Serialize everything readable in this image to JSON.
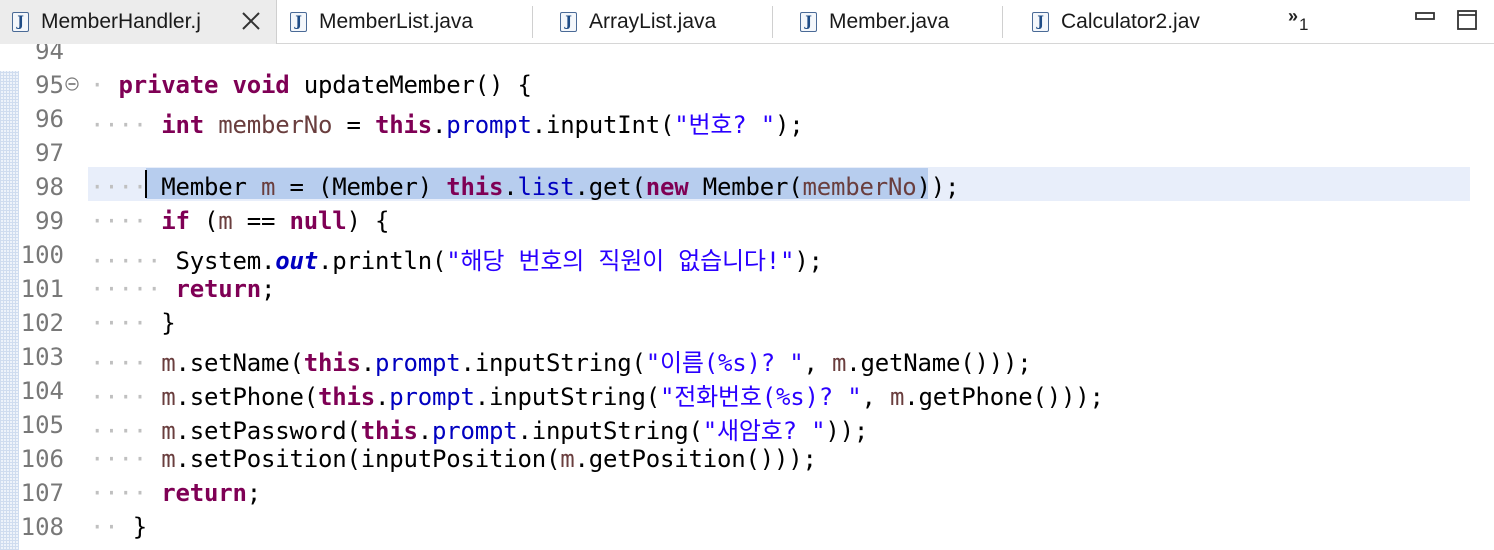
{
  "tabs": [
    {
      "label": "MemberHandler.j",
      "icon": "java-file-icon",
      "active": true
    },
    {
      "label": "MemberList.java",
      "icon": "java-file-icon"
    },
    {
      "label": "ArrayList.java",
      "icon": "java-file-icon"
    },
    {
      "label": "Member.java",
      "icon": "java-file-icon"
    },
    {
      "label": "Calculator2.jav",
      "icon": "java-file-icon"
    }
  ],
  "tab_overflow": {
    "label": "»",
    "count": "1"
  },
  "editor": {
    "lines": [
      {
        "num": "94",
        "code": ""
      },
      {
        "num": "95",
        "code": "private void updateMember() {"
      },
      {
        "num": "96",
        "code": "int memberNo = this.prompt.inputInt(\"번호? \");"
      },
      {
        "num": "97",
        "code": ""
      },
      {
        "num": "98",
        "code": "Member m = (Member) this.list.get(new Member(memberNo));"
      },
      {
        "num": "99",
        "code": "if (m == null) {"
      },
      {
        "num": "100",
        "code": "System.out.println(\"해당 번호의 직원이 없습니다!\");"
      },
      {
        "num": "101",
        "code": "return;"
      },
      {
        "num": "102",
        "code": "}"
      },
      {
        "num": "103",
        "code": "m.setName(this.prompt.inputString(\"이름(%s)? \", m.getName()));"
      },
      {
        "num": "104",
        "code": "m.setPhone(this.prompt.inputString(\"전화번호(%s)? \", m.getPhone()));"
      },
      {
        "num": "105",
        "code": "m.setPassword(this.prompt.inputString(\"새암호? \"));"
      },
      {
        "num": "106",
        "code": "m.setPosition(inputPosition(m.getPosition()));"
      },
      {
        "num": "107",
        "code": "return;"
      },
      {
        "num": "108",
        "code": "}"
      }
    ]
  },
  "colors": {
    "keyword": "#7f0055",
    "field": "#0000c0",
    "string": "#2a00ff",
    "local_variable": "#6a3e3e",
    "current_line": "#e8eefa",
    "selection": "#b7cdee"
  }
}
